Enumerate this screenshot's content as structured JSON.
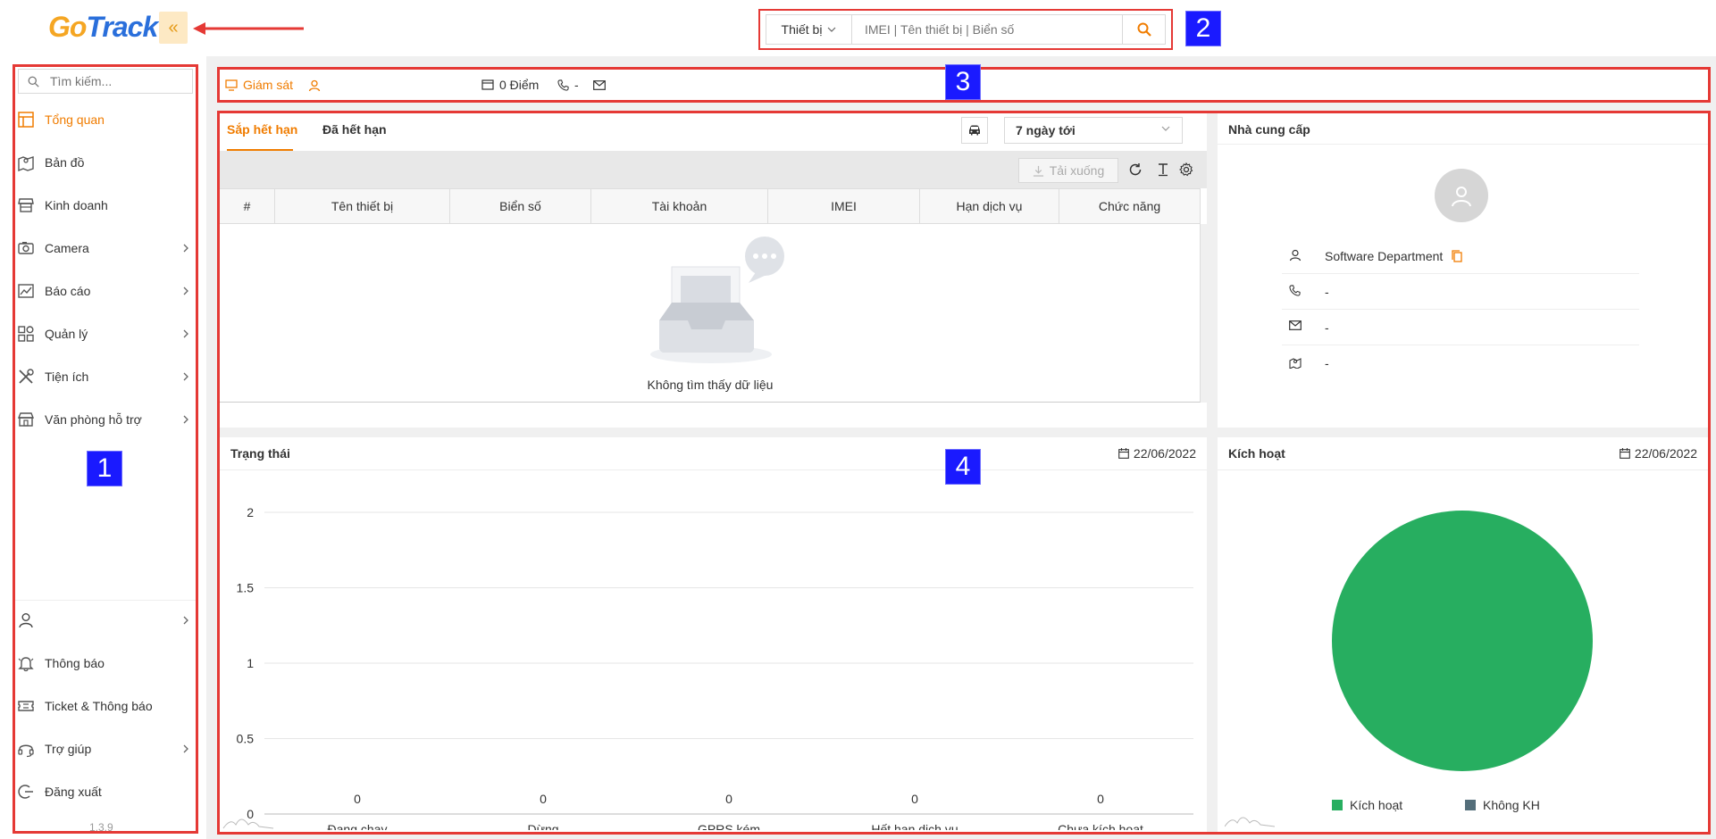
{
  "logo": {
    "part1": "Go",
    "part2": "Track"
  },
  "collapse_icon": "«",
  "search": {
    "type_label": "Thiết bị",
    "placeholder": "IMEI | Tên thiết bị | Biển số"
  },
  "badges": [
    "1",
    "2",
    "3",
    "4"
  ],
  "sidebar": {
    "search_placeholder": "Tìm kiếm...",
    "items": [
      {
        "label": "Tổng quan",
        "icon": "layout-icon",
        "chevron": false,
        "active": true
      },
      {
        "label": "Bản đồ",
        "icon": "map-icon",
        "chevron": false
      },
      {
        "label": "Kinh doanh",
        "icon": "store-icon",
        "chevron": false
      },
      {
        "label": "Camera",
        "icon": "camera-icon",
        "chevron": true
      },
      {
        "label": "Báo cáo",
        "icon": "chart-icon",
        "chevron": true
      },
      {
        "label": "Quản lý",
        "icon": "grid-icon",
        "chevron": true
      },
      {
        "label": "Tiện ích",
        "icon": "tools-icon",
        "chevron": true
      },
      {
        "label": "Văn phòng hỗ trợ",
        "icon": "office-icon",
        "chevron": true
      }
    ],
    "bottom_items": [
      {
        "label": "",
        "icon": "user-icon",
        "chevron": true
      },
      {
        "label": "Thông báo",
        "icon": "bell-icon",
        "chevron": false
      },
      {
        "label": "Ticket & Thông báo",
        "icon": "ticket-icon",
        "chevron": false
      },
      {
        "label": "Trợ giúp",
        "icon": "headset-icon",
        "chevron": true
      },
      {
        "label": "Đăng xuất",
        "icon": "logout-icon",
        "chevron": false
      }
    ],
    "version": "1.3.9"
  },
  "infobar": {
    "monitor_label": "Giám sát",
    "points": "0 Điểm",
    "phone": "-"
  },
  "table_panel": {
    "tab_active": "Sắp hết hạn",
    "tab_other": "Đã hết hạn",
    "range": "7 ngày tới",
    "download": "Tải xuống",
    "columns": [
      "#",
      "Tên thiết bị",
      "Biển số",
      "Tài khoản",
      "IMEI",
      "Hạn dịch vụ",
      "Chức năng"
    ],
    "empty": "Không tìm thấy dữ liệu"
  },
  "provider": {
    "title": "Nhà cung cấp",
    "name": "Software Department",
    "phone": "-",
    "email": "-",
    "address": "-"
  },
  "status_panel": {
    "title": "Trạng thái",
    "date": "22/06/2022"
  },
  "activation_panel": {
    "title": "Kích hoạt",
    "date": "22/06/2022"
  },
  "colors": {
    "accent": "#f07c00",
    "frame": "#e53935",
    "badge": "#1a1aff",
    "green": "#27ae60",
    "gray": "#546e7a"
  },
  "chart_data": [
    {
      "type": "bar",
      "title": "Trạng thái",
      "categories": [
        "Đang chạy",
        "Dừng",
        "GPRS kém",
        "Hết hạn dịch vụ",
        "Chưa kích hoạt"
      ],
      "values": [
        0,
        0,
        0,
        0,
        0
      ],
      "yticks": [
        "0",
        "0.5",
        "1",
        "1.5",
        "2"
      ],
      "ylim": [
        0,
        2
      ],
      "grid": true
    },
    {
      "type": "pie",
      "title": "Kích hoạt",
      "series": [
        {
          "name": "Kích hoạt",
          "value": 100,
          "color": "#27ae60"
        },
        {
          "name": "Không KH",
          "value": 0,
          "color": "#546e7a"
        }
      ],
      "legend": "bottom"
    }
  ]
}
